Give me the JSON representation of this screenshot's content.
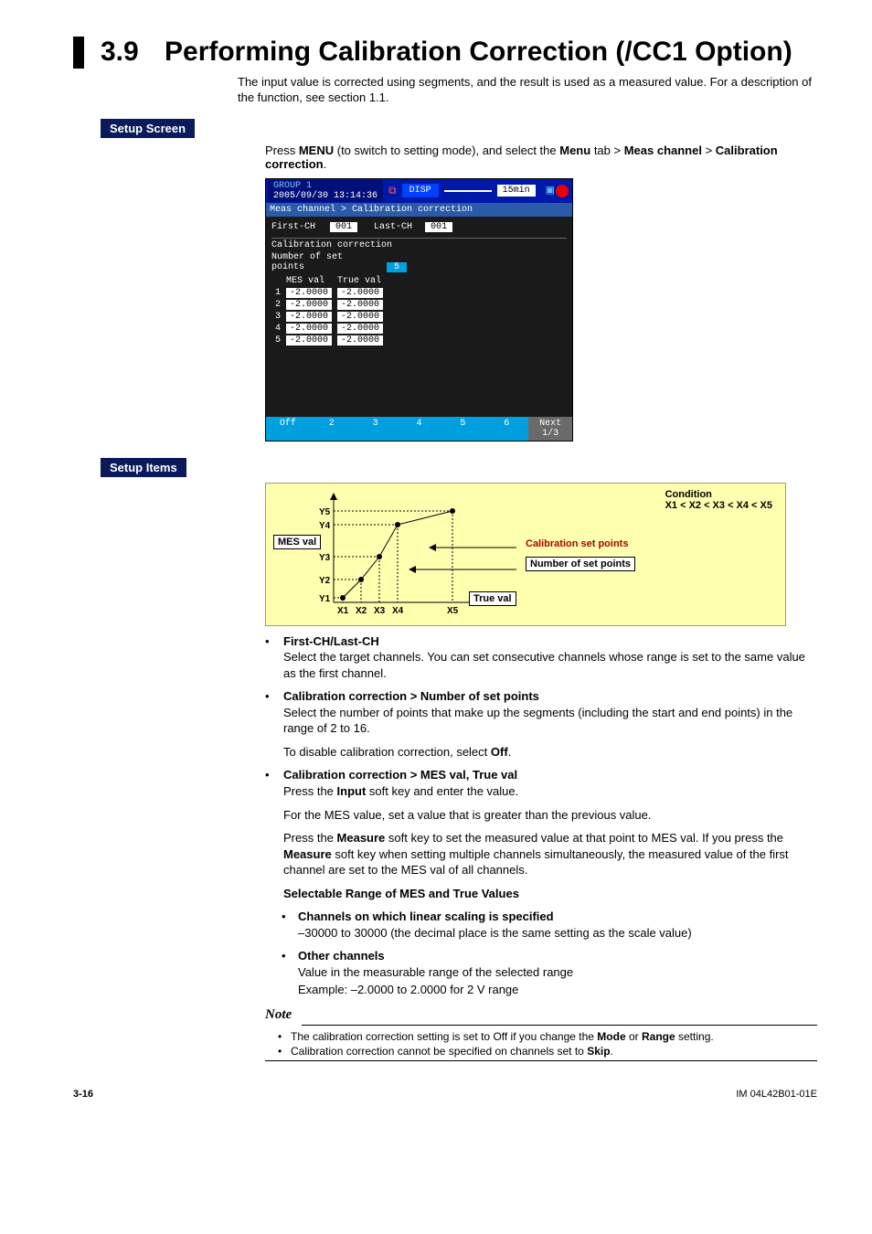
{
  "heading": {
    "num": "3.9",
    "title": "Performing Calibration Correction (/CC1 Option)"
  },
  "intro": "The input value is corrected using segments, and the result is used as a measured value. For a description of the function, see section 1.1.",
  "labels": {
    "setup_screen": "Setup Screen",
    "setup_items": "Setup Items"
  },
  "setup_screen_text": {
    "pre": "Press ",
    "menu": "MENU",
    "mid": " (to switch to setting mode), and select the ",
    "menu2": "Menu",
    "mid2": " tab > ",
    "meas": "Meas channel",
    "mid3": " > ",
    "cal": "Calibration correction",
    "end": "."
  },
  "screenshot": {
    "group": "GROUP 1",
    "datetime": "2005/09/30 13:14:36",
    "disp": "DISP",
    "interval": "15min",
    "crumb": "Meas channel > Calibration correction",
    "first_lbl": "First-CH",
    "first_val": "001",
    "last_lbl": "Last-CH",
    "last_val": "001",
    "cc_box": "Calibration correction",
    "nsp_lbl": "Number of set points",
    "nsp_val": "5",
    "col1": "MES val",
    "col2": "True val",
    "rows": [
      {
        "i": "1",
        "m": "-2.0000",
        "t": "-2.0000"
      },
      {
        "i": "2",
        "m": "-2.0000",
        "t": "-2.0000"
      },
      {
        "i": "3",
        "m": "-2.0000",
        "t": "-2.0000"
      },
      {
        "i": "4",
        "m": "-2.0000",
        "t": "-2.0000"
      },
      {
        "i": "5",
        "m": "-2.0000",
        "t": "-2.0000"
      }
    ],
    "soft": [
      "Off",
      "2",
      "3",
      "4",
      "5",
      "6",
      "Next 1/3"
    ]
  },
  "chart_data": {
    "type": "line",
    "x": [
      "X1",
      "X2",
      "X3",
      "X4",
      "X5"
    ],
    "series": [
      {
        "name": "calibration",
        "values": [
          1,
          2,
          3,
          4,
          5
        ]
      }
    ],
    "ylabels": [
      "Y1",
      "Y2",
      "Y3",
      "Y4",
      "Y5"
    ],
    "annotations": {
      "mes_val": "MES val",
      "true_val": "True val",
      "cond_title": "Condition",
      "cond_body": "X1 < X2 < X3 < X4 < X5",
      "csp": "Calibration set points",
      "nsp": "Number of set points"
    }
  },
  "items": {
    "first": {
      "h": "First-CH/Last-CH",
      "p": "Select the target channels. You can set consecutive channels whose range is set to the same value as the first channel."
    },
    "nsp": {
      "h": "Calibration correction > Number of set points",
      "p1": "Select the number of points that make up the segments (including the start and end points) in the range of 2 to 16.",
      "p2a": "To disable calibration correction, select ",
      "off": "Off",
      "p2b": "."
    },
    "mes": {
      "h": "Calibration correction > MES val, True val",
      "l1a": "Press the ",
      "input": "Input",
      "l1b": " soft key and enter the value.",
      "l2": "For the MES value, set a value that is greater than the previous value.",
      "l3a": "Press the ",
      "measure": "Measure",
      "l3b": " soft key to set the measured value at that point to MES val. If you press the ",
      "measure2": "Measure",
      "l3c": " soft key when setting multiple channels simultaneously, the measured value of the first channel are set to the MES val of all channels.",
      "sel": "Selectable Range of MES and True Values",
      "ch_lin": "Channels on which linear scaling is specified",
      "ch_lin_b": "–30000 to 30000 (the decimal place is the same setting as the scale value)",
      "ch_oth": "Other channels",
      "ch_oth_b1": "Value in the measurable range of the selected range",
      "ch_oth_b2": "Example: –2.0000 to 2.0000 for 2 V range"
    }
  },
  "note": {
    "head": "Note",
    "n1a": "The calibration correction setting is set to Off if you change the ",
    "mode": "Mode",
    "n1b": " or ",
    "range": "Range",
    "n1c": " setting.",
    "n2a": "Calibration correction cannot be specified on channels set to ",
    "skip": "Skip",
    "n2b": "."
  },
  "footer": {
    "page": "3-16",
    "doc": "IM 04L42B01-01E"
  }
}
